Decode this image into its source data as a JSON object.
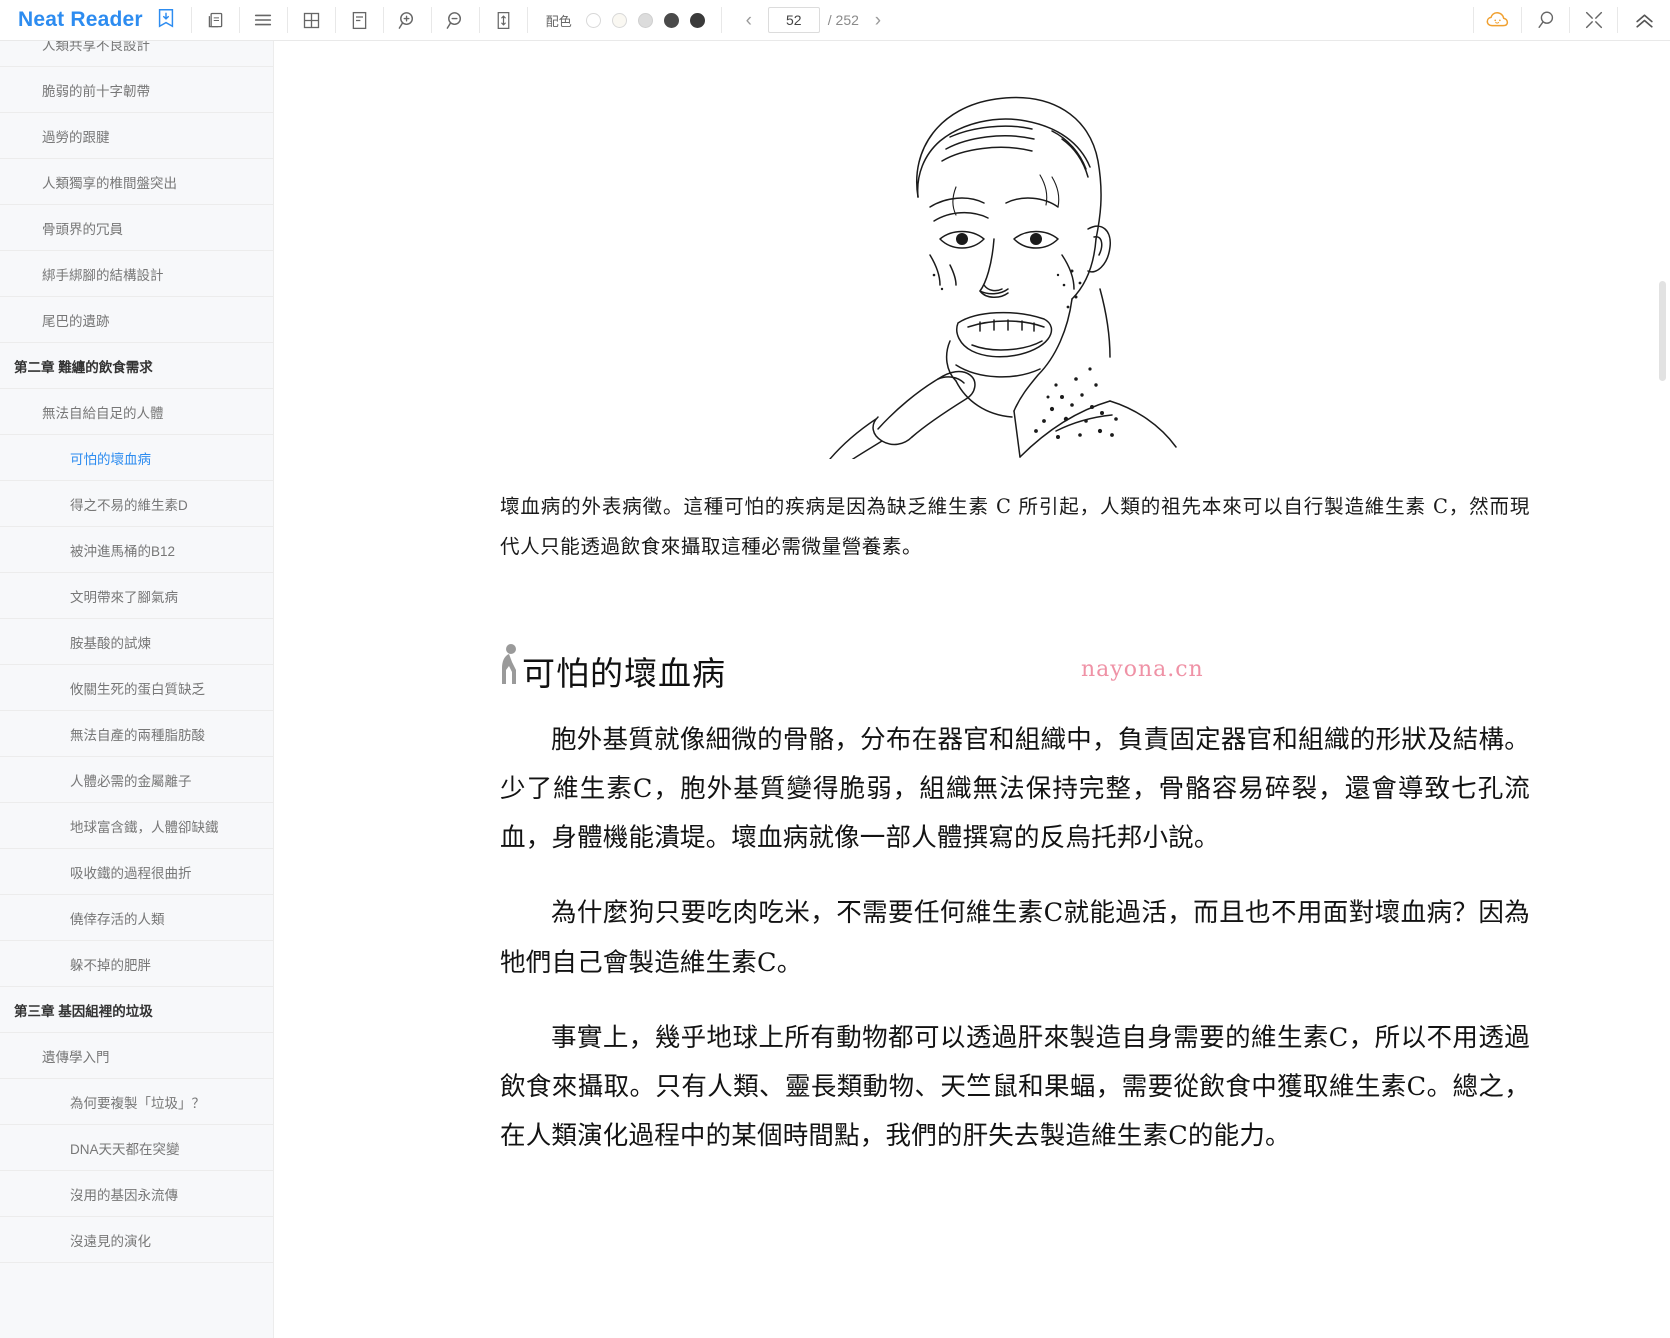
{
  "app": {
    "brand": "Neat Reader"
  },
  "toolbar": {
    "icons": [
      {
        "name": "save-book-icon",
        "label": "save"
      },
      {
        "name": "copy-page-icon",
        "label": "copy"
      },
      {
        "name": "toc-list-icon",
        "label": "contents"
      },
      {
        "name": "grid-layout-icon",
        "label": "grid"
      },
      {
        "name": "note-panel-icon",
        "label": "notes"
      },
      {
        "name": "zoom-in-icon",
        "label": "zoom in"
      },
      {
        "name": "zoom-out-icon",
        "label": "zoom out"
      },
      {
        "name": "fit-height-icon",
        "label": "fit height"
      }
    ],
    "scheme_label": "配色",
    "swatches": [
      "#ffffff",
      "#faf7f0",
      "#d8d8d8",
      "#4a4a4a",
      "#3a3a3a"
    ],
    "selected_swatch_index": 0,
    "pager": {
      "prev_glyph": "‹",
      "next_glyph": "›",
      "current_page": "52",
      "total_label": "/ 252",
      "placeholder": "52"
    },
    "right_icons": [
      {
        "name": "cloud-sync-icon",
        "label": "cloud",
        "color": "#f0a030"
      },
      {
        "name": "search-icon",
        "label": "search"
      },
      {
        "name": "collapse-icon",
        "label": "collapse"
      },
      {
        "name": "chevron-up-double-icon",
        "label": "scroll to top"
      }
    ]
  },
  "sidebar": {
    "items": [
      {
        "label": "人類共享不良設計",
        "level": 2,
        "active": false,
        "clipped": true
      },
      {
        "label": "脆弱的前十字韌帶",
        "level": 2,
        "active": false
      },
      {
        "label": "過勞的跟腱",
        "level": 2,
        "active": false
      },
      {
        "label": "人類獨享的椎間盤突出",
        "level": 2,
        "active": false
      },
      {
        "label": "骨頭界的冗員",
        "level": 2,
        "active": false
      },
      {
        "label": "綁手綁腳的結構設計",
        "level": 2,
        "active": false
      },
      {
        "label": "尾巴的遺跡",
        "level": 2,
        "active": false
      },
      {
        "label": "第二章 難纏的飲食需求",
        "level": 1,
        "active": false
      },
      {
        "label": "無法自給自足的人體",
        "level": 2,
        "active": false
      },
      {
        "label": "可怕的壞血病",
        "level": 3,
        "active": true
      },
      {
        "label": "得之不易的維生素D",
        "level": 3,
        "active": false
      },
      {
        "label": "被沖進馬桶的B12",
        "level": 3,
        "active": false
      },
      {
        "label": "文明帶來了腳氣病",
        "level": 3,
        "active": false
      },
      {
        "label": "胺基酸的試煉",
        "level": 3,
        "active": false
      },
      {
        "label": "攸關生死的蛋白質缺乏",
        "level": 3,
        "active": false
      },
      {
        "label": "無法自產的兩種脂肪酸",
        "level": 3,
        "active": false
      },
      {
        "label": "人體必需的金屬離子",
        "level": 3,
        "active": false
      },
      {
        "label": "地球富含鐵，人體卻缺鐵",
        "level": 3,
        "active": false
      },
      {
        "label": "吸收鐵的過程很曲折",
        "level": 3,
        "active": false
      },
      {
        "label": "僥倖存活的人類",
        "level": 3,
        "active": false
      },
      {
        "label": "躲不掉的肥胖",
        "level": 3,
        "active": false
      },
      {
        "label": "第三章 基因組裡的垃圾",
        "level": 1,
        "active": false
      },
      {
        "label": "遺傳學入門",
        "level": 2,
        "active": false
      },
      {
        "label": "為何要複製「垃圾」？",
        "level": 3,
        "active": false
      },
      {
        "label": "DNA天天都在突變",
        "level": 3,
        "active": false
      },
      {
        "label": "沒用的基因永流傳",
        "level": 3,
        "active": false
      },
      {
        "label": "沒遠見的演化",
        "level": 3,
        "active": false
      }
    ]
  },
  "content": {
    "illustration_alt": "scurvy-patient-illustration",
    "caption": "壞血病的外表病徵。這種可怕的疾病是因為缺乏維生素 C 所引起，人類的祖先本來可以自行製造維生素 C，然而現代人只能透過飲食來攝取這種必需微量營養素。",
    "watermark": "nayona.cn",
    "section_heading": "可怕的壞血病",
    "paragraphs": [
      "胞外基質就像細微的骨骼，分布在器官和組織中，負責固定器官和組織的形狀及結構。少了維生素C，胞外基質變得脆弱，組織無法保持完整，骨骼容易碎裂，還會導致七孔流血，身體機能潰堤。壞血病就像一部人體撰寫的反烏托邦小說。",
      "為什麼狗只要吃肉吃米，不需要任何維生素C就能過活，而且也不用面對壞血病？因為牠們自己會製造維生素C。",
      "事實上，幾乎地球上所有動物都可以透過肝來製造自身需要的維生素C，所以不用透過飲食來攝取。只有人類、靈長類動物、天竺鼠和果蝠，需要從飲食中獲取維生素C。總之，在人類演化過程中的某個時間點，我們的肝失去製造維生素C的能力。"
    ]
  },
  "colors": {
    "brand_blue": "#2d8cf0",
    "sidebar_bg": "#f7f8fa",
    "watermark_pink": "#ef92a6",
    "cloud_orange": "#f0a030"
  }
}
